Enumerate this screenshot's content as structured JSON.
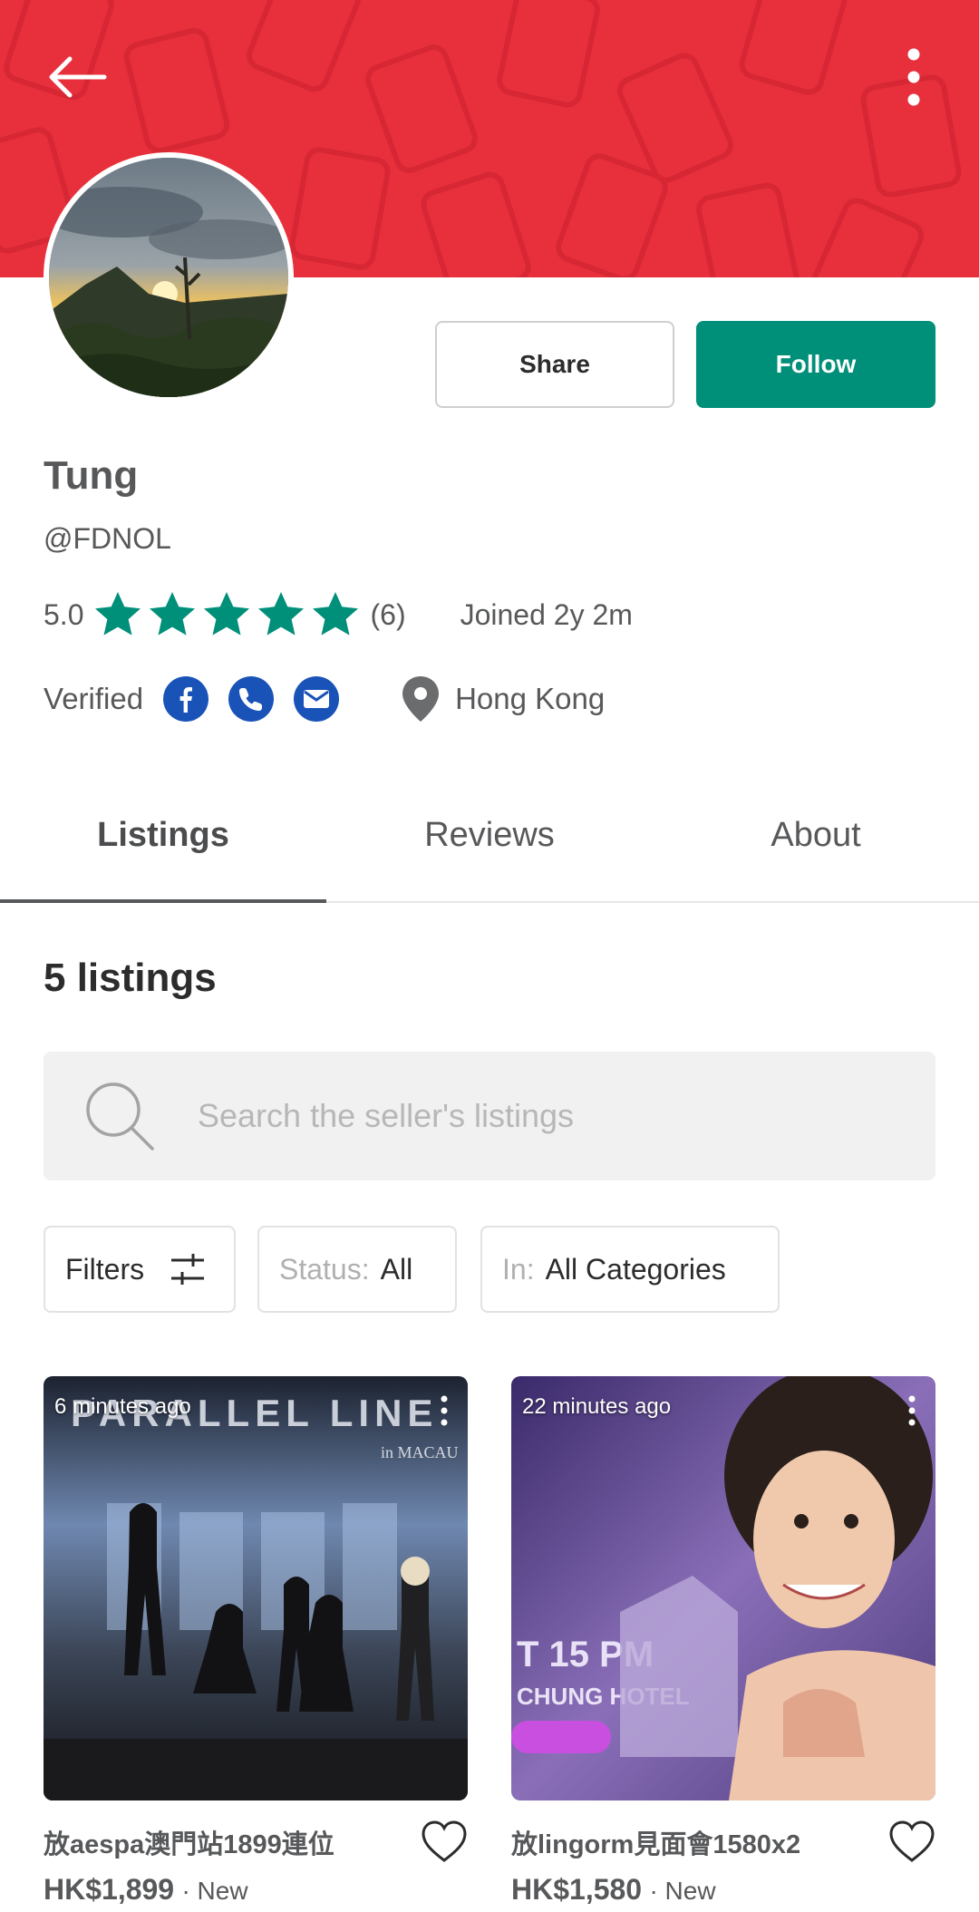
{
  "header": {
    "back_icon": "arrow-left-icon",
    "more_icon": "vertical-dots-icon",
    "banner_color": "#e8303c"
  },
  "profile": {
    "share_label": "Share",
    "follow_label": "Follow",
    "name": "Tung",
    "handle": "@FDNOL",
    "rating": "5.0",
    "rating_count": "(6)",
    "stars": 5,
    "joined": "Joined 2y 2m",
    "verified_label": "Verified",
    "verified_icons": [
      "facebook-icon",
      "phone-icon",
      "email-icon"
    ],
    "location": "Hong Kong",
    "accent_color": "#008f79"
  },
  "tabs": [
    {
      "label": "Listings",
      "active": true
    },
    {
      "label": "Reviews",
      "active": false
    },
    {
      "label": "About",
      "active": false
    }
  ],
  "listings": {
    "count_label": "5 listings",
    "search_placeholder": "Search the seller's listings",
    "filters_label": "Filters",
    "status_prefix": "Status:",
    "status_value": "All",
    "in_prefix": "In:",
    "category_value": "All Categories"
  },
  "items": [
    {
      "time": "6 minutes ago",
      "title": "放aespa澳門站1899連位",
      "price": "HK$1,899",
      "condition": "· New"
    },
    {
      "time": "22 minutes ago",
      "title": "放lingorm見面會1580x2",
      "price": "HK$1,580",
      "condition": "· New"
    }
  ]
}
